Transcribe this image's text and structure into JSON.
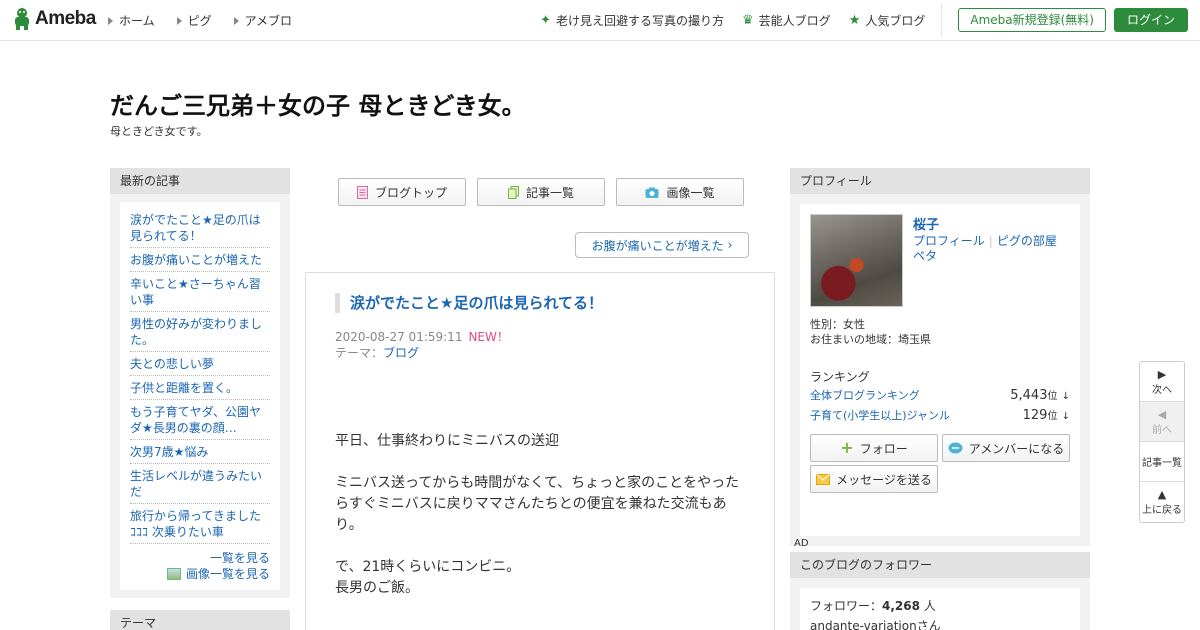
{
  "header": {
    "logo_text": "Ameba",
    "nav": [
      "ホーム",
      "ピグ",
      "アメブロ"
    ],
    "links": [
      {
        "icon": "sparkle-icon",
        "label": "老け見え回避する写真の撮り方"
      },
      {
        "icon": "crown-icon",
        "label": "芸能人ブログ"
      },
      {
        "icon": "star-icon",
        "label": "人気ブログ"
      }
    ],
    "register_label": "Ameba新規登録(無料)",
    "login_label": "ログイン"
  },
  "blog": {
    "title": "だんご三兄弟＋女の子 母ときどき女。",
    "description": "母ときどき女です。"
  },
  "recent": {
    "heading": "最新の記事",
    "items": [
      "涙がでたこと★足の爪は見られてる！",
      "お腹が痛いことが増えた",
      "辛いこと★さーちゃん習い事",
      "男性の好みが変わりました。",
      "夫との悲しい夢",
      "子供と距離を置く。",
      "もう子育てヤダ、公園ヤダ★長男の裏の顔…",
      "次男7歳★悩み",
      "生活レベルが違うみたいだ",
      "旅行から帰ってきました ｺｺｺ 次乗りたい車"
    ],
    "see_all": "一覧を見る",
    "see_images": "画像一覧を見る"
  },
  "theme_heading": "テーマ",
  "tabs": [
    "ブログトップ",
    "記事一覧",
    "画像一覧"
  ],
  "next_article": "お腹が痛いことが増えた",
  "article": {
    "title": "涙がでたこと★足の爪は見られてる！",
    "date": "2020-08-27 01:59:11",
    "new_badge": "NEW！",
    "theme_label": "テーマ：",
    "theme": "ブログ",
    "paragraphs": [
      "平日、仕事終わりにミニバスの送迎",
      "ミニバス送ってからも時間がなくて、ちょっと家のことをやったらすぐミニバスに戻りママさんたちとの便宜を兼ねた交流もあり。",
      "で、21時くらいにコンビニ。\n長男のご飯。"
    ]
  },
  "profile": {
    "heading": "プロフィール",
    "name": "桜子",
    "link_profile": "プロフィール",
    "link_room": "ピグの部屋",
    "link_peta": "ペタ",
    "gender": "性別：女性",
    "region": "お住まいの地域：埼玉県",
    "ranking_heading": "ランキング",
    "rankings": [
      {
        "label": "全体ブログランキング",
        "value": "5,443",
        "unit": "位",
        "trend": "↓"
      },
      {
        "label": "子育て(小学生以上)ジャンル",
        "value": "129",
        "unit": "位",
        "trend": "↓"
      }
    ],
    "follow_label": "フォロー",
    "member_label": "アメンバーになる",
    "message_label": "メッセージを送る"
  },
  "ad_label": "AD",
  "followers": {
    "heading": "このブログのフォロワー",
    "count_label": "フォロワー：",
    "count": "4,268",
    "count_unit": "人",
    "first": "andante-variationさん"
  },
  "pager": {
    "next": "次へ",
    "prev": "前へ",
    "list": "記事一覧",
    "top": "上に戻る"
  },
  "colors": {
    "brand_green": "#2d8c3c",
    "link_blue": "#1a66b3",
    "new_pink": "#e5468c"
  }
}
